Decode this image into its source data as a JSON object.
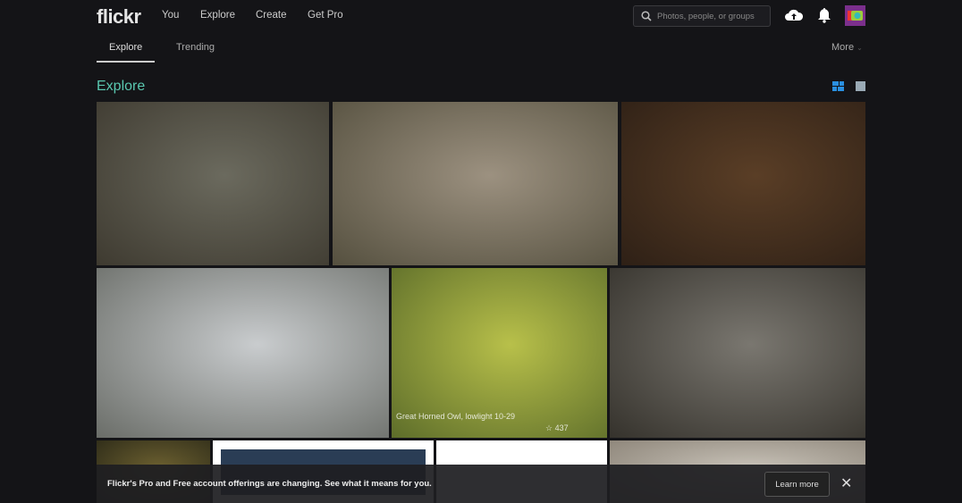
{
  "header": {
    "logo": "flickr",
    "nav": [
      "You",
      "Explore",
      "Create",
      "Get Pro"
    ],
    "search_placeholder": "Photos, people, or groups"
  },
  "tabs": {
    "items": [
      "Explore",
      "Trending"
    ],
    "more": "More"
  },
  "page_title": "Explore",
  "photos": [
    {
      "title": "",
      "colors": [
        "#6b6a5e",
        "#3e3a30"
      ]
    },
    {
      "title": "",
      "colors": [
        "#9c9180",
        "#55503f"
      ]
    },
    {
      "title": "",
      "colors": [
        "#5a3e26",
        "#2e2016"
      ]
    },
    {
      "title": "",
      "colors": [
        "#c9ccce",
        "#6a6d68"
      ]
    },
    {
      "title": "Great Horned Owl, lowlight 10-29",
      "colors": [
        "#b8c04a",
        "#5d6d2a"
      ],
      "favorites": "437"
    },
    {
      "title": "",
      "colors": [
        "#7a7770",
        "#35322c"
      ]
    },
    {
      "title": "",
      "colors": [
        "#6c6030",
        "#2c2a18"
      ]
    },
    {
      "title": "",
      "colors": [
        "#ffffff",
        "#2a3d55"
      ]
    },
    {
      "title": "",
      "colors": [
        "#ffffff",
        "#7d98b8"
      ]
    },
    {
      "title": "",
      "colors": [
        "#c8c2b8",
        "#8a8276"
      ]
    }
  ],
  "banner": {
    "text": "Flickr's Pro and Free account offerings are changing. See what it means for you.",
    "button": "Learn more"
  }
}
